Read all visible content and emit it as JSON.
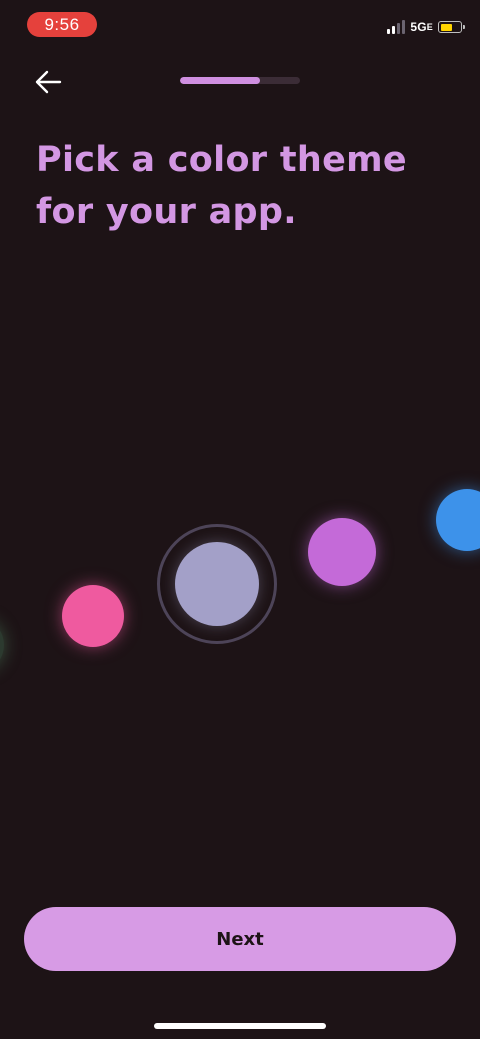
{
  "status_bar": {
    "time": "9:56",
    "network_main": "5G",
    "network_suffix": "E",
    "battery_level": 0.6,
    "battery_color": "#ffd400",
    "time_pill_color": "#e5413c"
  },
  "header": {
    "back_icon": "arrow-left-icon",
    "progress": 0.67
  },
  "title": "Pick a color theme for your app.",
  "swatches": [
    {
      "name": "green",
      "color": "#2c3a2f"
    },
    {
      "name": "pink",
      "color": "#ef5a9f"
    },
    {
      "name": "lavender",
      "color": "#a3a0c8",
      "selected": true
    },
    {
      "name": "purple",
      "color": "#c46ad8"
    },
    {
      "name": "blue",
      "color": "#3d92ea"
    }
  ],
  "footer": {
    "next_label": "Next",
    "next_color": "#d79be5"
  },
  "colors": {
    "background": "#1d1316",
    "accent": "#d397e3"
  }
}
